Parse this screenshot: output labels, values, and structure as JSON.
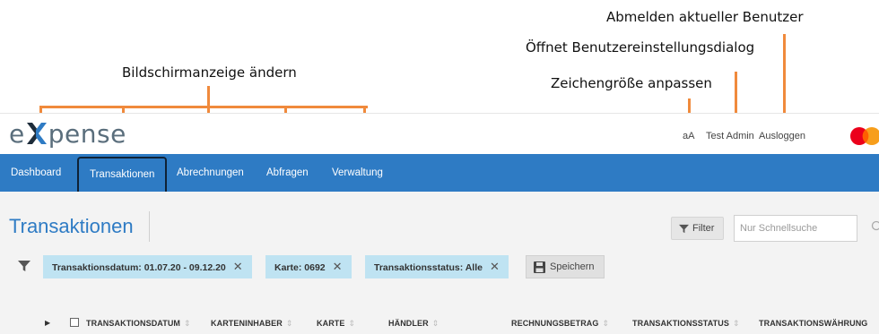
{
  "annotations": {
    "logout": "Abmelden aktueller Benutzer",
    "user_settings": "Öffnet Benutzereinstellungsdialog",
    "font_size": "Zeichengröße anpassen",
    "change_view": "Bildschirmanzeige ändern"
  },
  "header": {
    "logo": "expense",
    "logo_pre": "e",
    "logo_post": "pense",
    "font_size_link": "aA",
    "user_name": "Test Admin",
    "logout_link": "Ausloggen"
  },
  "nav": {
    "items": [
      {
        "label": "Dashboard"
      },
      {
        "label": "Transaktionen",
        "active": true
      },
      {
        "label": "Abrechnungen"
      },
      {
        "label": "Abfragen"
      },
      {
        "label": "Verwaltung"
      }
    ]
  },
  "page": {
    "title": "Transaktionen",
    "filter_button": "Filter",
    "search_placeholder": "Nur Schnellsuche"
  },
  "filters": {
    "chips": [
      {
        "label": "Transaktionsdatum: 01.07.20 - 09.12.20"
      },
      {
        "label": "Karte: 0692"
      },
      {
        "label": "Transaktionsstatus: Alle"
      }
    ],
    "remove_glyph": "✕",
    "save_button": "Speichern"
  },
  "table": {
    "columns": [
      "TRANSAKTIONSDATUM",
      "KARTENINHABER",
      "KARTE",
      "HÄNDLER",
      "RECHNUNGSBETRAG",
      "TRANSAKTIONSSTATUS",
      "TRANSAKTIONSWÄHRUNG"
    ],
    "sort_glyph": "⇕"
  },
  "colors": {
    "nav_bg": "#2E7BC4",
    "accent_orange": "#F08A3C",
    "chip_bg": "#BFE3F2",
    "title_blue": "#2E7BC4"
  }
}
